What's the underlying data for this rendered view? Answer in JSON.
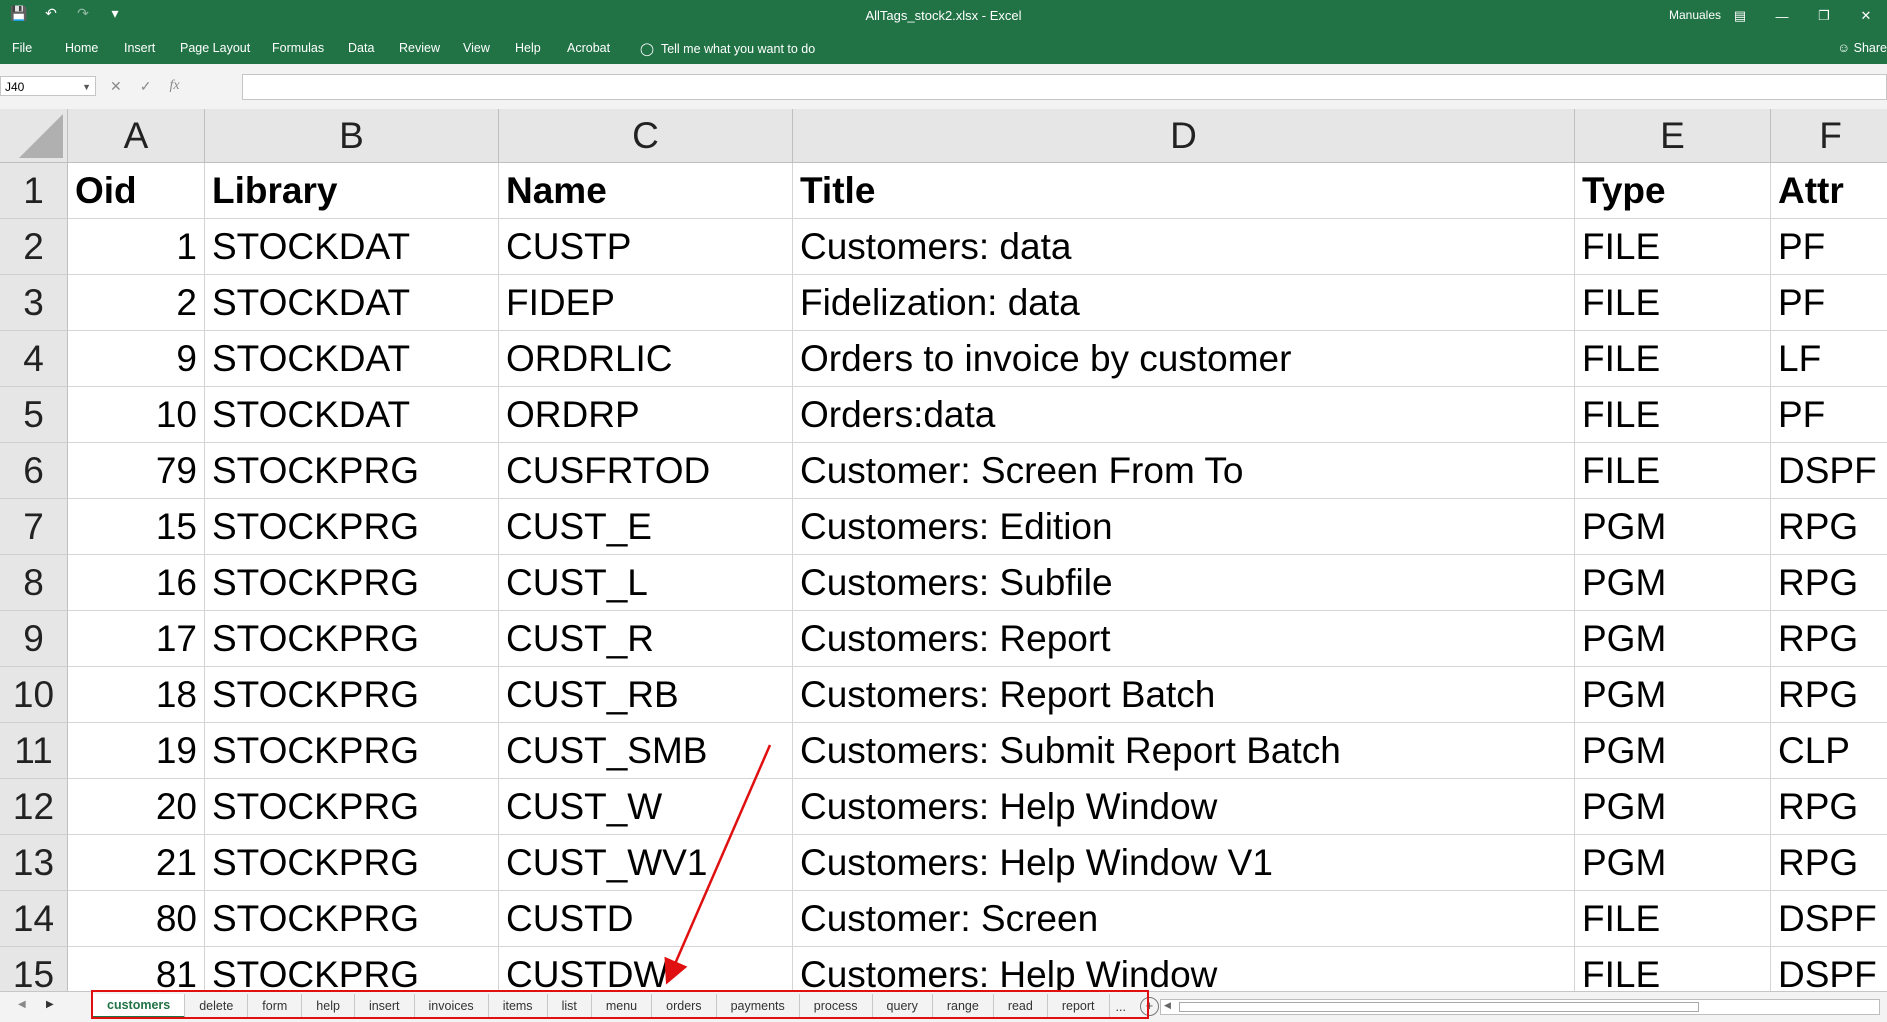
{
  "window": {
    "title": "AllTags_stock2.xlsx  -  Excel",
    "account": "Manuales",
    "share_label": "Share",
    "qat_icons": [
      "save-icon",
      "undo-icon",
      "redo-icon",
      "customize-icon"
    ],
    "window_controls": [
      "ribbon-display-icon",
      "minimize-icon",
      "restore-icon",
      "close-icon"
    ]
  },
  "menu": {
    "tabs": [
      "File",
      "Home",
      "Insert",
      "Page Layout",
      "Formulas",
      "Data",
      "Review",
      "View",
      "Help",
      "Acrobat"
    ],
    "tell_me": "Tell me what you want to do"
  },
  "formula_bar": {
    "name_box": "J40",
    "fx_label": "fx",
    "content": ""
  },
  "sheet": {
    "columns": [
      "A",
      "B",
      "C",
      "D",
      "E",
      "F"
    ],
    "header_row": {
      "num": "1",
      "cells": [
        "Oid",
        "Library",
        "Name",
        "Title",
        "Type",
        "Attr"
      ]
    },
    "rows": [
      {
        "num": "2",
        "cells": [
          "1",
          "STOCKDAT",
          "CUSTP",
          "Customers: data",
          "FILE",
          "PF"
        ]
      },
      {
        "num": "3",
        "cells": [
          "2",
          "STOCKDAT",
          "FIDEP",
          "Fidelization: data",
          "FILE",
          "PF"
        ]
      },
      {
        "num": "4",
        "cells": [
          "9",
          "STOCKDAT",
          "ORDRLIC",
          "Orders to invoice by customer",
          "FILE",
          "LF"
        ]
      },
      {
        "num": "5",
        "cells": [
          "10",
          "STOCKDAT",
          "ORDRP",
          "Orders:data",
          "FILE",
          "PF"
        ]
      },
      {
        "num": "6",
        "cells": [
          "79",
          "STOCKPRG",
          "CUSFRTOD",
          "Customer: Screen From To",
          "FILE",
          "DSPF"
        ]
      },
      {
        "num": "7",
        "cells": [
          "15",
          "STOCKPRG",
          "CUST_E",
          "Customers: Edition",
          "PGM",
          "RPG"
        ]
      },
      {
        "num": "8",
        "cells": [
          "16",
          "STOCKPRG",
          "CUST_L",
          "Customers: Subfile",
          "PGM",
          "RPG"
        ]
      },
      {
        "num": "9",
        "cells": [
          "17",
          "STOCKPRG",
          "CUST_R",
          "Customers: Report",
          "PGM",
          "RPG"
        ]
      },
      {
        "num": "10",
        "cells": [
          "18",
          "STOCKPRG",
          "CUST_RB",
          "Customers: Report Batch",
          "PGM",
          "RPG"
        ]
      },
      {
        "num": "11",
        "cells": [
          "19",
          "STOCKPRG",
          "CUST_SMB",
          "Customers: Submit Report Batch",
          "PGM",
          "CLP"
        ]
      },
      {
        "num": "12",
        "cells": [
          "20",
          "STOCKPRG",
          "CUST_W",
          "Customers: Help Window",
          "PGM",
          "RPG"
        ]
      },
      {
        "num": "13",
        "cells": [
          "21",
          "STOCKPRG",
          "CUST_WV1",
          "Customers: Help Window  V1",
          "PGM",
          "RPG"
        ]
      },
      {
        "num": "14",
        "cells": [
          "80",
          "STOCKPRG",
          "CUSTD",
          "Customer: Screen",
          "FILE",
          "DSPF"
        ]
      },
      {
        "num": "15",
        "cells": [
          "81",
          "STOCKPRG",
          "CUSTDW",
          "Customers: Help Window",
          "FILE",
          "DSPF"
        ]
      }
    ]
  },
  "sheet_tabs": {
    "active": "customers",
    "tabs": [
      "customers",
      "delete",
      "form",
      "help",
      "insert",
      "invoices",
      "items",
      "list",
      "menu",
      "orders",
      "payments",
      "process",
      "query",
      "range",
      "read",
      "report"
    ],
    "more_label": "..."
  },
  "colors": {
    "accent": "#217346",
    "annotation": "#e01010"
  }
}
